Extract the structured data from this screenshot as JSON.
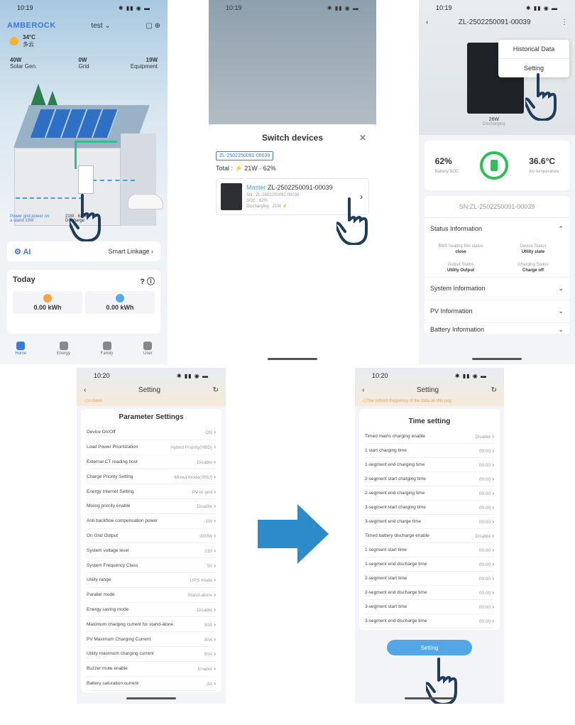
{
  "phone1": {
    "time": "10:19",
    "brand": "AMBEROCK",
    "device_selector": "test",
    "temp": "34°C",
    "temp_sub": "多云",
    "powers": [
      {
        "value": "40W",
        "label": "Solar Gen."
      },
      {
        "value": "0W",
        "label": "Grid"
      },
      {
        "value": "19W",
        "label": "Equipment"
      }
    ],
    "note_left": "Power grid power on a stand 19W",
    "note_right": "21W · 62%",
    "note_right_sub": "Discharge",
    "ai_label": "AI",
    "smart_linkage": "Smart Linkage",
    "today": "Today",
    "kwh": [
      "0.00 kWh",
      "0.00 kWh"
    ],
    "tabs": [
      "Home",
      "Energy",
      "Family",
      "User"
    ]
  },
  "phone2": {
    "time": "10:19",
    "sheet_title": "Switch devices",
    "tag": "ZL-2502250091-00039",
    "total": "Total : ⚡ 21W · 62%",
    "master": "Master",
    "device_name": "ZL-2502250091-00039",
    "sn": "SN : ZL-2502250091-00039",
    "soc": "SOC : 62%",
    "status": "Discharging : 21W ⚡"
  },
  "phone3": {
    "time": "10:19",
    "title": "ZL-2502250091-00039",
    "menu": [
      "Historical Data",
      "Setting"
    ],
    "power": "26W",
    "power_label": "Discharging",
    "soc": "62%",
    "soc_label": "Battery SOC",
    "temp": "36.6°C",
    "temp_label": "Inv temperature",
    "sn": "SN:ZL-2502250091-00039",
    "status_title": "Status Information",
    "status_items": [
      {
        "label": "BMS heating film status",
        "value": "close"
      },
      {
        "label": "Device Status",
        "value": "Utility state"
      },
      {
        "label": "Output Status",
        "value": "Utility Output"
      },
      {
        "label": "Charging Status",
        "value": "Charge off"
      }
    ],
    "sections": [
      "System Information",
      "PV Information",
      "Battery Information"
    ]
  },
  "phone4": {
    "time": "10:20",
    "title": "Setting",
    "warn": "n-Geen",
    "card_title": "Parameter Settings",
    "rows": [
      {
        "label": "Device On/Off",
        "value": "ON"
      },
      {
        "label": "Load Power Prioritization",
        "value": "Hybrid Priority(HBD)"
      },
      {
        "label": "External CT reading host",
        "value": "Disable"
      },
      {
        "label": "Charge Priority Setting",
        "value": "Mixed mode(SNU)"
      },
      {
        "label": "Energy Internet Setting",
        "value": "PV to grid"
      },
      {
        "label": "Mixing priority enable",
        "value": "Disable"
      },
      {
        "label": "Anti backflow compensation power",
        "value": "-1W"
      },
      {
        "label": "On Grid Output",
        "value": "800W"
      },
      {
        "label": "System voltage level",
        "value": "230"
      },
      {
        "label": "System Frequency Class",
        "value": "50"
      },
      {
        "label": "Utility range",
        "value": "UPS mode"
      },
      {
        "label": "Parallel mode",
        "value": "Stand-alone"
      },
      {
        "label": "Energy saving mode",
        "value": "Disable"
      },
      {
        "label": "Maximum charging current for stand-alone",
        "value": "50A"
      },
      {
        "label": "PV Maximum Charging Current",
        "value": "40A"
      },
      {
        "label": "Utility maximum charging current",
        "value": "50A"
      },
      {
        "label": "Buzzer mute enable",
        "value": "Enable"
      },
      {
        "label": "Battery saturation current",
        "value": "3A"
      }
    ]
  },
  "phone5": {
    "time": "10:20",
    "title": "Setting",
    "warn": "The refresh frequency of the data on this pag",
    "card_title": "Time setting",
    "rows": [
      {
        "label": "Timed mains charging enable",
        "value": "Disable"
      },
      {
        "label": "1 start charging time",
        "value": "00:00"
      },
      {
        "label": "1-segment end charging time",
        "value": "00:00"
      },
      {
        "label": "2-segment start charging time",
        "value": "00:00"
      },
      {
        "label": "2-segment end charging time",
        "value": "00:00"
      },
      {
        "label": "3-segment start charging time",
        "value": "00:00"
      },
      {
        "label": "3-segment end charge time",
        "value": "00:00"
      },
      {
        "label": "Timed battery discharge enable",
        "value": "Disable"
      },
      {
        "label": "1 segment start time",
        "value": "00:00"
      },
      {
        "label": "1-segment end discharge time",
        "value": "00:00"
      },
      {
        "label": "2-segment start time",
        "value": "00:00"
      },
      {
        "label": "2-segment end discharge time",
        "value": "00:00"
      },
      {
        "label": "3-segment start time",
        "value": "00:00"
      },
      {
        "label": "3-segment end discharge time",
        "value": "00:00"
      }
    ],
    "button": "Setting"
  },
  "colors": {
    "accent": "#3a7ad8",
    "button": "#53a7e6",
    "arrow": "#2e8bc9",
    "battery": "#2bbf5a"
  }
}
